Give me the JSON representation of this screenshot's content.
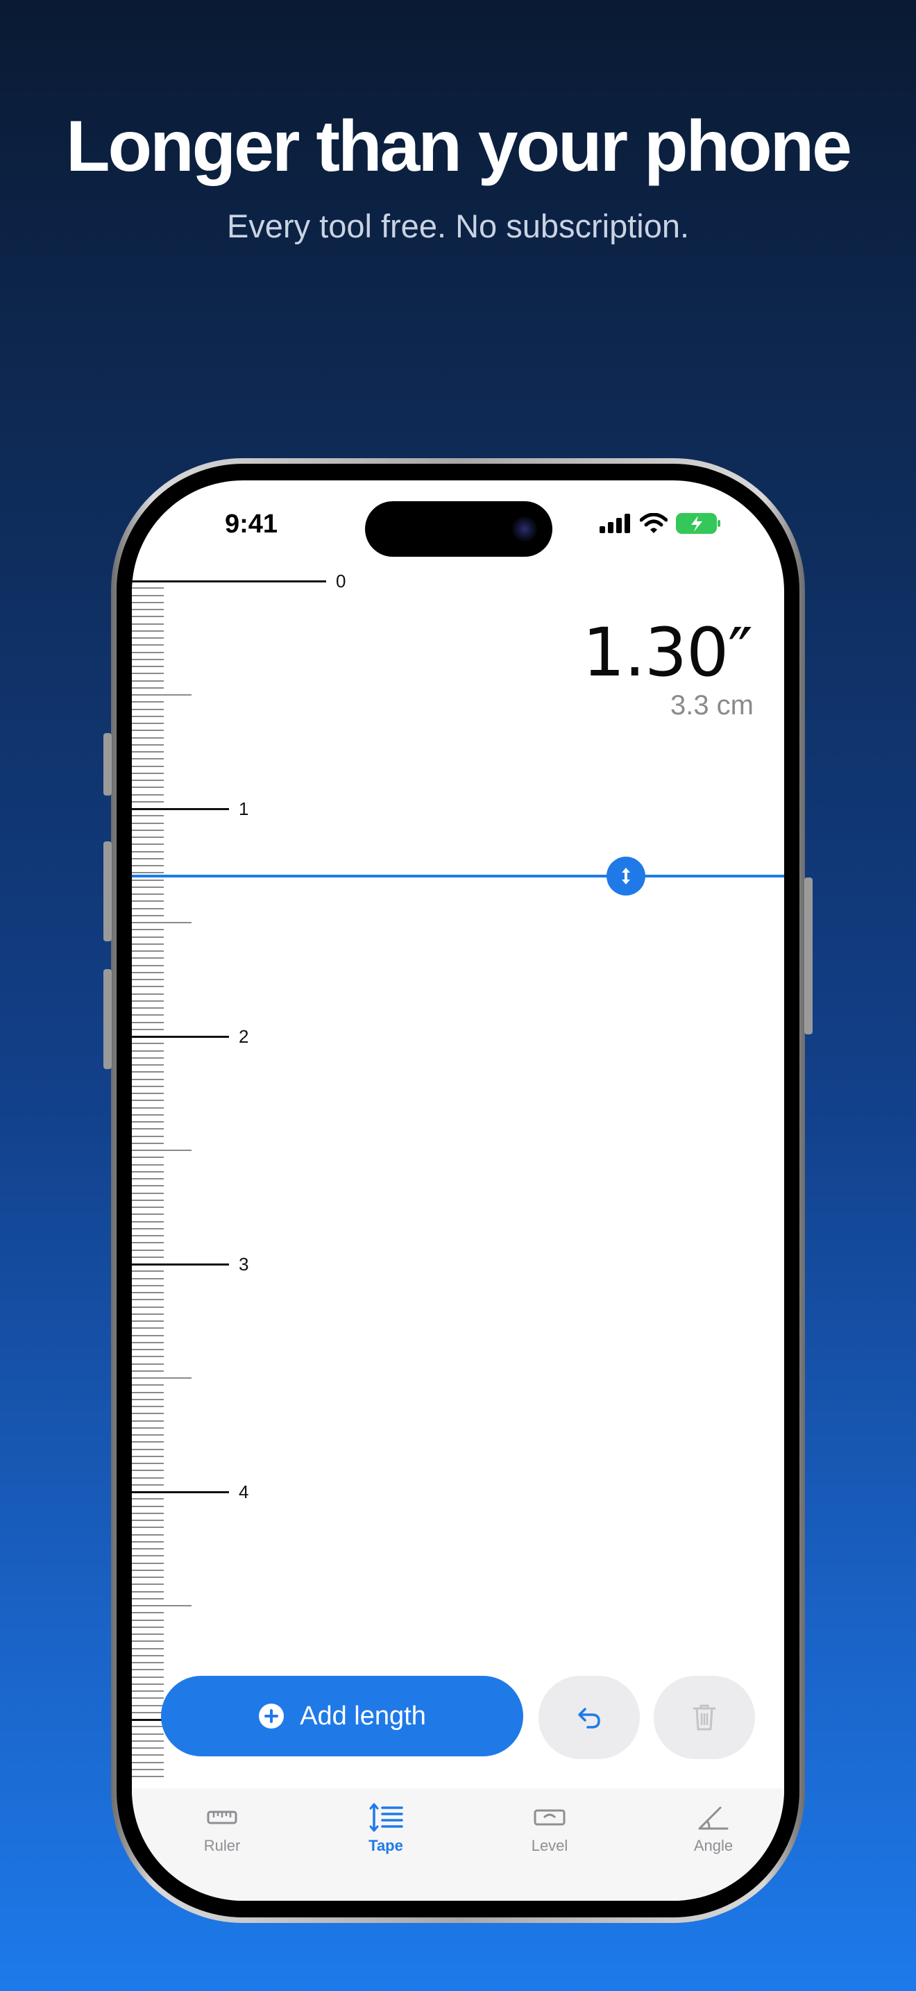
{
  "marketing": {
    "headline": "Longer than your phone",
    "subheadline": "Every tool free. No subscription."
  },
  "status_bar": {
    "time": "9:41",
    "icons": [
      "signal-icon",
      "wifi-icon",
      "battery-charging-icon"
    ]
  },
  "measurement": {
    "inches": "1.30″",
    "centimeters": "3.3 cm",
    "value_inches": 1.3
  },
  "ruler": {
    "unit": "inches",
    "labels": [
      "0",
      "1",
      "2",
      "3",
      "4"
    ]
  },
  "actions": {
    "add_length_label": "Add length",
    "undo_icon": "undo-icon",
    "delete_icon": "trash-icon"
  },
  "tabs": [
    {
      "label": "Ruler",
      "icon": "ruler-icon",
      "active": false
    },
    {
      "label": "Tape",
      "icon": "tape-list-icon",
      "active": true
    },
    {
      "label": "Level",
      "icon": "level-icon",
      "active": false
    },
    {
      "label": "Angle",
      "icon": "angle-icon",
      "active": false
    }
  ],
  "colors": {
    "accent": "#1f7ae8",
    "tab_inactive": "#8e8e93",
    "battery_green": "#34c759"
  }
}
